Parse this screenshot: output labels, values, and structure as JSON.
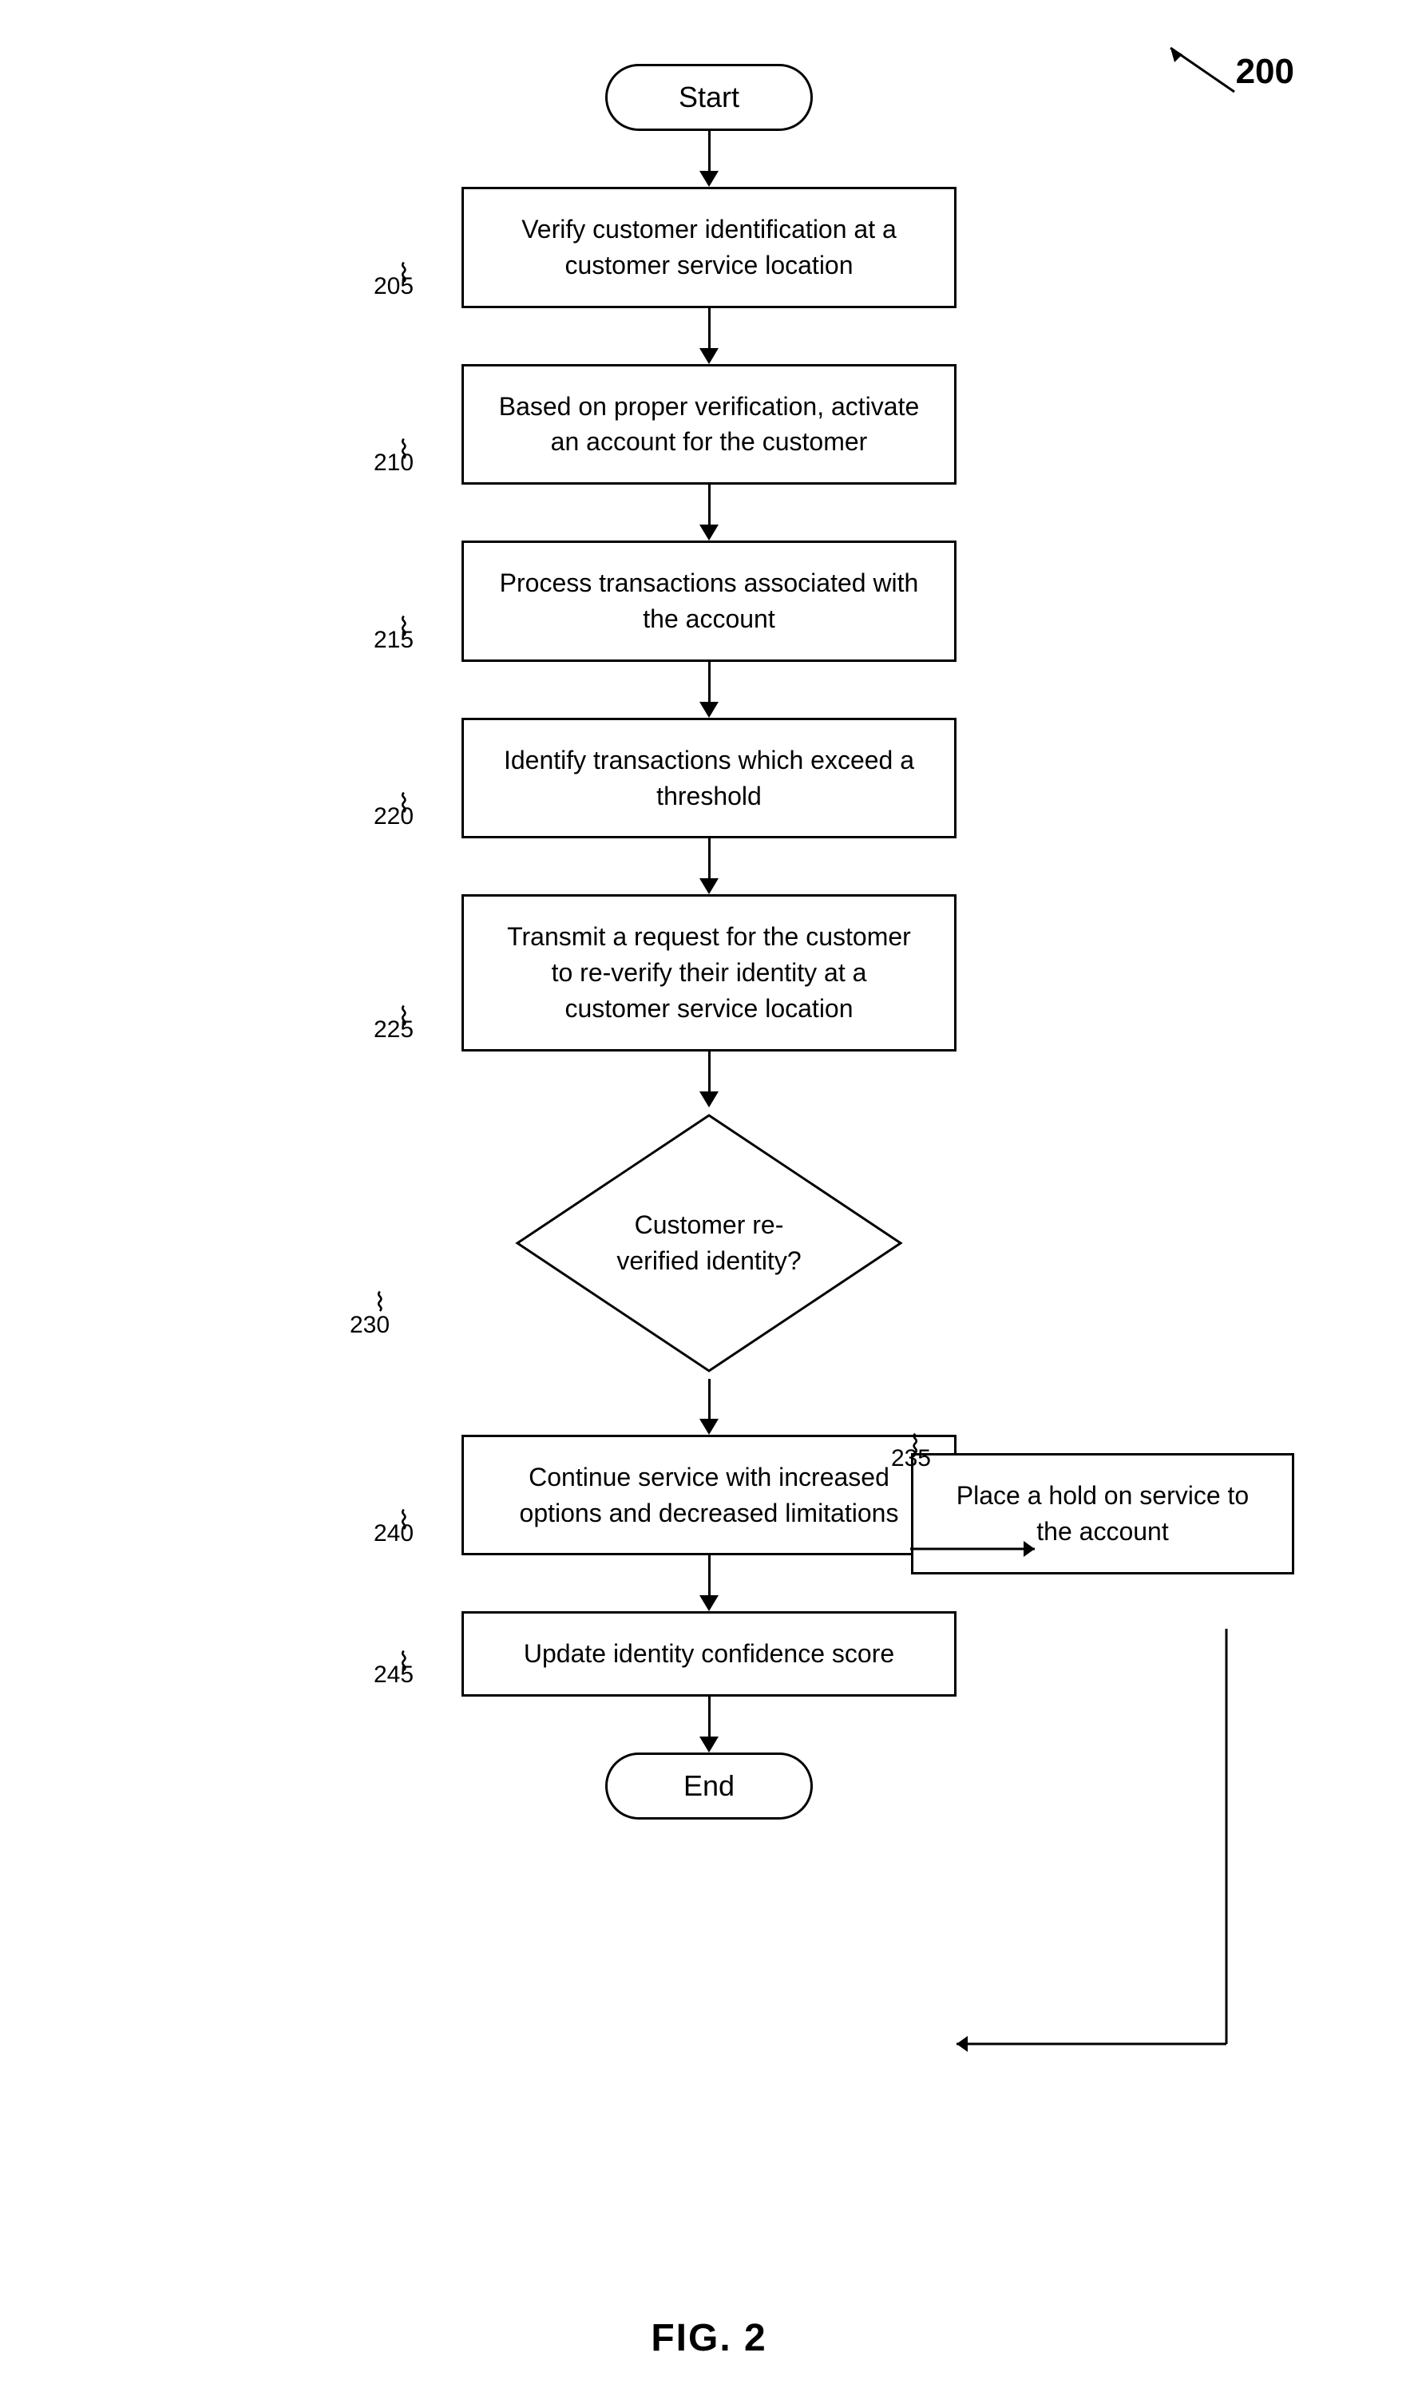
{
  "diagram": {
    "number": "200",
    "fig_label": "FIG. 2",
    "nodes": {
      "start": "Start",
      "end": "End",
      "step205": {
        "label": "205",
        "text": "Verify customer identification at a customer service location"
      },
      "step210": {
        "label": "210",
        "text": "Based on proper verification, activate an account for the customer"
      },
      "step215": {
        "label": "215",
        "text": "Process transactions associated with the account"
      },
      "step220": {
        "label": "220",
        "text": "Identify transactions which exceed a threshold"
      },
      "step225": {
        "label": "225",
        "text": "Transmit a request for the customer to re-verify their identity at a customer service location"
      },
      "step230": {
        "label": "230",
        "diamond_text": "Customer re-verified identity?"
      },
      "step235": {
        "label": "235",
        "text": "Place a hold on service to the account"
      },
      "step240": {
        "label": "240",
        "text": "Continue service with increased options and decreased limitations"
      },
      "step245": {
        "label": "245",
        "text": "Update identity confidence score"
      }
    }
  }
}
